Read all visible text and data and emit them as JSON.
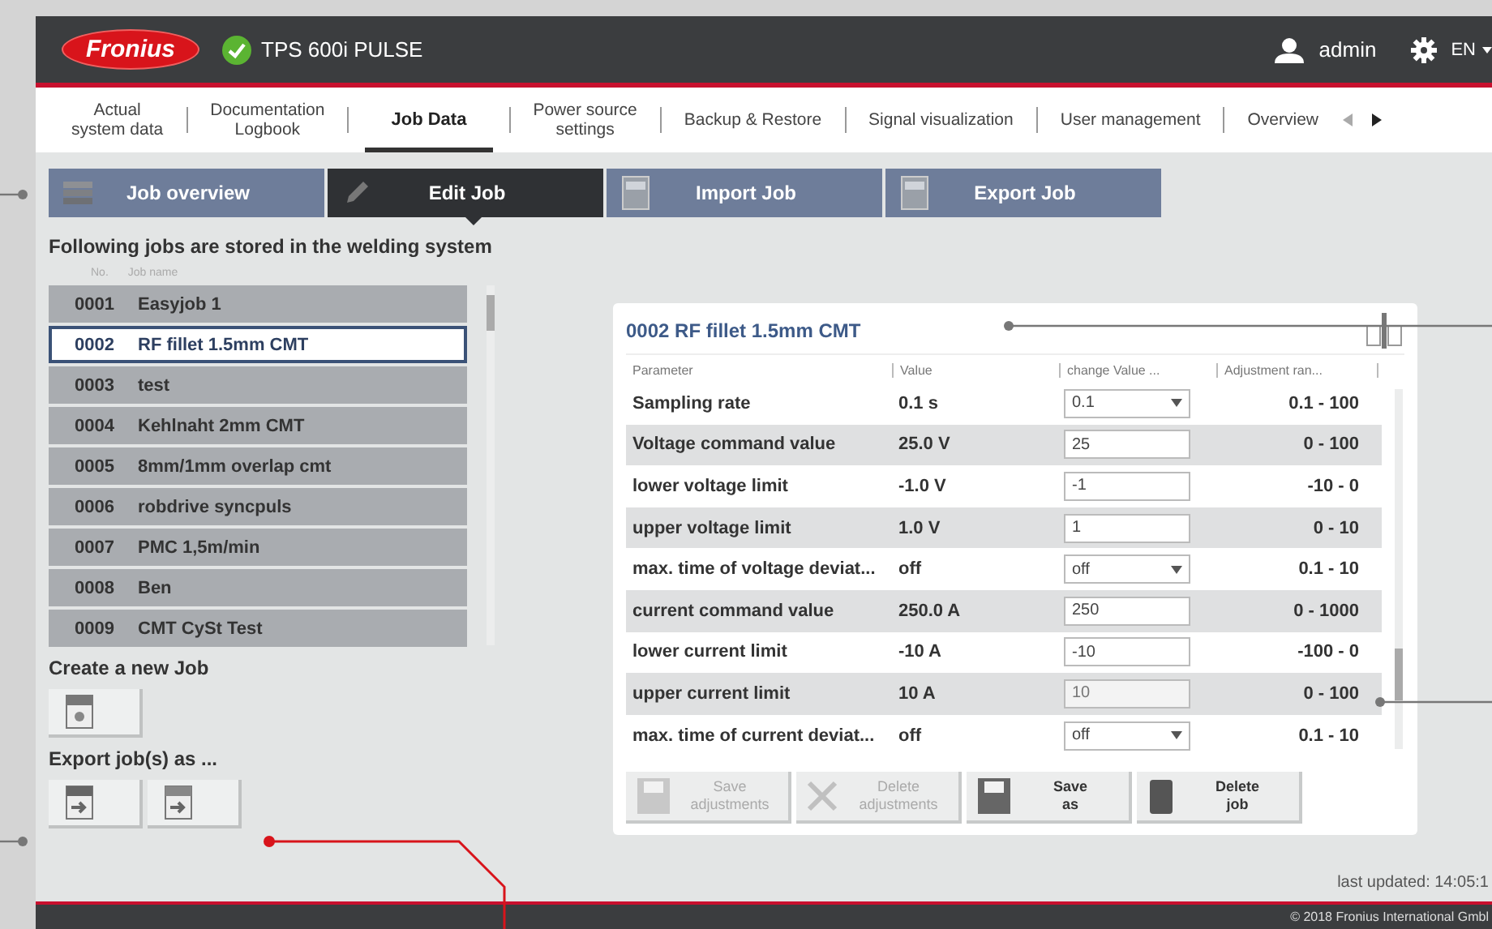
{
  "header": {
    "logo": "Fronius",
    "device": {
      "name": "TPS 600i PULSE",
      "connected": true
    },
    "user": "admin",
    "language": "EN"
  },
  "nav": [
    {
      "label": "Actual\nsystem data",
      "selected": false
    },
    {
      "label": "Documentation\nLogbook",
      "selected": false
    },
    {
      "label": "Job Data",
      "selected": true
    },
    {
      "label": "Power source\nsettings",
      "selected": false
    },
    {
      "label": "Backup & Restore",
      "selected": false
    },
    {
      "label": "Signal visualization",
      "selected": false
    },
    {
      "label": "User management",
      "selected": false
    },
    {
      "label": "Overview",
      "selected": false
    }
  ],
  "subtabs": [
    {
      "label": "Job overview",
      "kind": "list",
      "selected": false
    },
    {
      "label": "Edit Job",
      "kind": "edit",
      "selected": true
    },
    {
      "label": "Import Job",
      "kind": "import",
      "selected": false
    },
    {
      "label": "Export Job",
      "kind": "export",
      "selected": false
    }
  ],
  "jobs": {
    "heading": "Following jobs are stored in the welding system",
    "columns": [
      "No.",
      "Job name"
    ],
    "rows": [
      {
        "number": "0001",
        "name": "Easyjob 1",
        "selected": false
      },
      {
        "number": "0002",
        "name": "RF fillet 1.5mm CMT",
        "selected": true
      },
      {
        "number": "0003",
        "name": "test",
        "selected": false
      },
      {
        "number": "0004",
        "name": "Kehlnaht 2mm CMT",
        "selected": false
      },
      {
        "number": "0005",
        "name": "8mm/1mm overlap cmt",
        "selected": false
      },
      {
        "number": "0006",
        "name": "robdrive syncpuls",
        "selected": false
      },
      {
        "number": "0007",
        "name": "PMC 1,5m/min",
        "selected": false
      },
      {
        "number": "0008",
        "name": "Ben",
        "selected": false
      },
      {
        "number": "0009",
        "name": "CMT CySt Test",
        "selected": false
      }
    ]
  },
  "create_job": {
    "heading": "Create a new Job"
  },
  "export_jobs": {
    "heading": "Export job(s) as ...",
    "buttons": [
      {
        "kind": "pdf"
      },
      {
        "kind": "xml"
      }
    ]
  },
  "job_detail": {
    "title": "0002 RF fillet 1.5mm CMT",
    "columns": [
      "Parameter",
      "Value",
      "change Value ...",
      "Adjustment ran..."
    ],
    "rows": [
      {
        "parameter": "Sampling rate",
        "value": "0.1 s",
        "field": {
          "kind": "select",
          "value": "0.1",
          "disabled": false
        },
        "range": "0.1 - 100"
      },
      {
        "parameter": "Voltage command value",
        "value": "25.0 V",
        "field": {
          "kind": "text",
          "value": "25",
          "disabled": false
        },
        "range": "0 - 100"
      },
      {
        "parameter": "lower voltage limit",
        "value": "-1.0 V",
        "field": {
          "kind": "text",
          "value": "-1",
          "disabled": false
        },
        "range": "-10 - 0"
      },
      {
        "parameter": "upper voltage limit",
        "value": "1.0 V",
        "field": {
          "kind": "text",
          "value": "1",
          "disabled": false
        },
        "range": "0 - 10"
      },
      {
        "parameter": "max. time of voltage deviat...",
        "value": "off",
        "field": {
          "kind": "select",
          "value": "off",
          "disabled": false
        },
        "range": "0.1 - 10"
      },
      {
        "parameter": "current command value",
        "value": "250.0 A",
        "field": {
          "kind": "text",
          "value": "250",
          "disabled": false
        },
        "range": "0 - 1000"
      },
      {
        "parameter": "lower current limit",
        "value": "-10 A",
        "field": {
          "kind": "text",
          "value": "-10",
          "disabled": false
        },
        "range": "-100 - 0"
      },
      {
        "parameter": "upper current limit",
        "value": "10 A",
        "field": {
          "kind": "text",
          "value": "10",
          "disabled": true
        },
        "range": "0 - 100"
      },
      {
        "parameter": "max. time of current deviat...",
        "value": "off",
        "field": {
          "kind": "select",
          "value": "off",
          "disabled": false
        },
        "range": "0.1 - 10"
      }
    ],
    "actions": [
      {
        "label": "Save\nadjustments",
        "kind": "save",
        "disabled": true
      },
      {
        "label": "Delete\nadjustments",
        "kind": "delete",
        "disabled": true
      },
      {
        "label": "Save\nas",
        "kind": "save-as",
        "disabled": false
      },
      {
        "label": "Delete\njob",
        "kind": "trash",
        "disabled": false
      }
    ]
  },
  "status": {
    "last_updated": "last updated: 14:05:1",
    "copyright": "© 2018 Fronius International Gmbl"
  }
}
